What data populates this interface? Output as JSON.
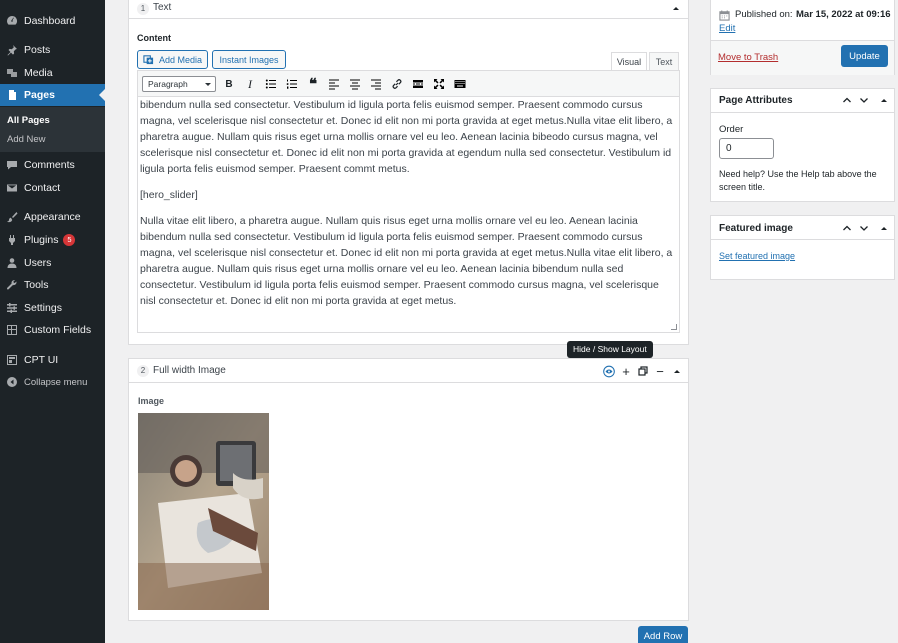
{
  "sidebar": {
    "items": [
      {
        "label": "Dashboard",
        "icon": "dashboard-icon"
      },
      {
        "label": "Posts",
        "icon": "pin-icon"
      },
      {
        "label": "Media",
        "icon": "media-icon"
      },
      {
        "label": "Pages",
        "icon": "pages-icon",
        "active": true
      },
      {
        "label": "Comments",
        "icon": "comments-icon"
      },
      {
        "label": "Contact",
        "icon": "mail-icon"
      },
      {
        "label": "Appearance",
        "icon": "brush-icon"
      },
      {
        "label": "Plugins",
        "icon": "plugin-icon",
        "badge": "5"
      },
      {
        "label": "Users",
        "icon": "users-icon"
      },
      {
        "label": "Tools",
        "icon": "wrench-icon"
      },
      {
        "label": "Settings",
        "icon": "settings-icon"
      },
      {
        "label": "Custom Fields",
        "icon": "grid-icon"
      },
      {
        "label": "CPT UI",
        "icon": "cpt-icon"
      },
      {
        "label": "Collapse menu",
        "icon": "collapse-icon"
      }
    ],
    "submenu": [
      "All Pages",
      "Add New"
    ]
  },
  "editor": {
    "row1": {
      "num": "1",
      "title": "Text"
    },
    "content_label": "Content",
    "add_media": "Add Media",
    "instant_images": "Instant Images",
    "tabs": {
      "visual": "Visual",
      "text": "Text"
    },
    "format": "Paragraph",
    "paragraphs": [
      "bibendum nulla sed consectetur. Vestibulum id ligula porta felis euismod semper. Praesent commodo cursus magna, vel scelerisque nisl consectetur et. Donec id elit non mi porta gravida at eget metus.Nulla vitae elit libero, a pharetra augue. Nullam quis risus eget urna mollis ornare vel eu leo. Aenean lacinia bibeodo cursus magna, vel scelerisque nisl consectetur et. Donec id elit non mi porta gravida at egendum nulla sed consectetur. Vestibulum id ligula porta felis euismod semper. Praesent commt metus.",
      "[hero_slider]",
      "Nulla vitae elit libero, a pharetra augue. Nullam quis risus eget urna mollis ornare vel eu leo. Aenean lacinia bibendum nulla sed consectetur. Vestibulum id ligula porta felis euismod semper. Praesent commodo cursus magna, vel scelerisque nisl consectetur et. Donec id elit non mi porta gravida at eget metus.Nulla vitae elit libero, a pharetra augue. Nullam quis risus eget urna mollis ornare vel eu leo. Aenean lacinia bibendum nulla sed consectetur. Vestibulum id ligula porta felis euismod semper. Praesent commodo cursus magna, vel scelerisque nisl consectetur et. Donec id elit non mi porta gravida at eget metus."
    ],
    "row2": {
      "num": "2",
      "title": "Full width Image"
    },
    "image_label": "Image",
    "tooltip": "Hide / Show Layout",
    "add_row": "Add Row"
  },
  "publish": {
    "published_label": "Published on:",
    "published_date": "Mar 15, 2022 at 09:16",
    "edit": "Edit",
    "trash": "Move to Trash",
    "update": "Update"
  },
  "page_attributes": {
    "title": "Page Attributes",
    "order_label": "Order",
    "order_value": "0",
    "help": "Need help? Use the Help tab above the screen title."
  },
  "featured": {
    "title": "Featured image",
    "set_link": "Set featured image"
  },
  "colors": {
    "accent": "#2271b1",
    "sidebar": "#1d2327",
    "badge": "#d63638"
  }
}
